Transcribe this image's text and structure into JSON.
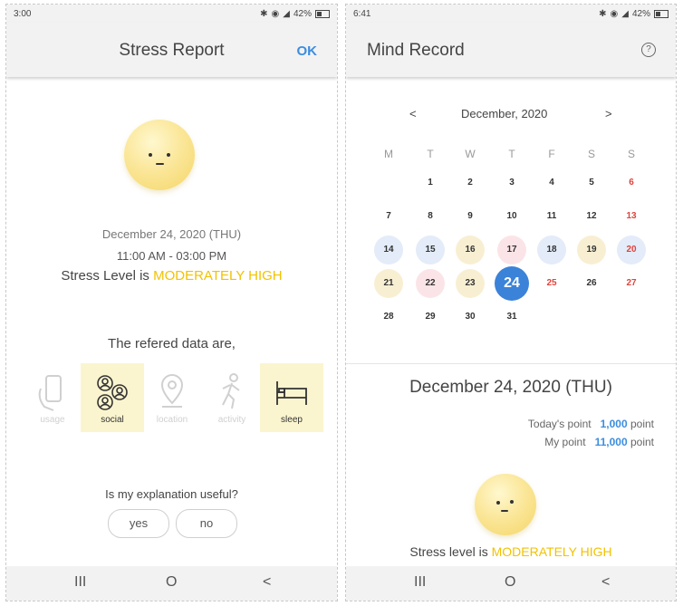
{
  "left": {
    "status_time": "3:00",
    "status_batt": "42%",
    "title": "Stress Report",
    "ok_label": "OK",
    "date": "December 24, 2020 (THU)",
    "time_range": "11:00 AM - 03:00 PM",
    "stress_prefix": "Stress Level is ",
    "stress_level": "MODERATELY HIGH",
    "refered_text": "The refered data are,",
    "data_items": [
      {
        "label": "usage",
        "active": false,
        "icon": "phone-hand-icon"
      },
      {
        "label": "social",
        "active": true,
        "icon": "people-network-icon"
      },
      {
        "label": "location",
        "active": false,
        "icon": "map-pin-icon"
      },
      {
        "label": "activity",
        "active": false,
        "icon": "walking-person-icon"
      },
      {
        "label": "sleep",
        "active": true,
        "icon": "bed-icon"
      }
    ],
    "question": "Is my explanation useful?",
    "yes_label": "yes",
    "no_label": "no"
  },
  "right": {
    "status_time": "6:41",
    "status_batt": "42%",
    "title": "Mind Record",
    "help_symbol": "?",
    "prev": "<",
    "next": ">",
    "month": "December, 2020",
    "weekdays": [
      "M",
      "T",
      "W",
      "T",
      "F",
      "S",
      "S"
    ],
    "weeks": [
      [
        "",
        "1",
        "2",
        "3",
        "4",
        "5",
        "6"
      ],
      [
        "7",
        "8",
        "9",
        "10",
        "11",
        "12",
        "13"
      ],
      [
        "14",
        "15",
        "16",
        "17",
        "18",
        "19",
        "20"
      ],
      [
        "21",
        "22",
        "23",
        "24",
        "25",
        "26",
        "27"
      ],
      [
        "28",
        "29",
        "30",
        "31",
        "",
        "",
        ""
      ]
    ],
    "day_colors": {
      "14": "#e3ecf8",
      "15": "#e3ecf8",
      "16": "#f8efd3",
      "17": "#fbe4e7",
      "18": "#e3ecf8",
      "19": "#f8efd3",
      "20": "#e3ecf8",
      "21": "#f8efd3",
      "22": "#fbe4e7",
      "23": "#f8efd3"
    },
    "red_days": [
      "6",
      "13",
      "20",
      "25",
      "27"
    ],
    "selected_day": "24",
    "date_heading": "December 24, 2020 (THU)",
    "todays_point_label": "Today's point",
    "todays_point_value": "1,000",
    "my_point_label": "My point",
    "my_point_value": "11,000",
    "point_unit": "point",
    "stress_prefix": "Stress level is ",
    "stress_level": "MODERATELY HIGH"
  },
  "nav": {
    "recent": "III",
    "home": "O",
    "back": "<"
  },
  "colors": {
    "accent_blue": "#3b8de0",
    "highlight_yellow": "#f2c200",
    "weekend_red": "#e0433a"
  }
}
